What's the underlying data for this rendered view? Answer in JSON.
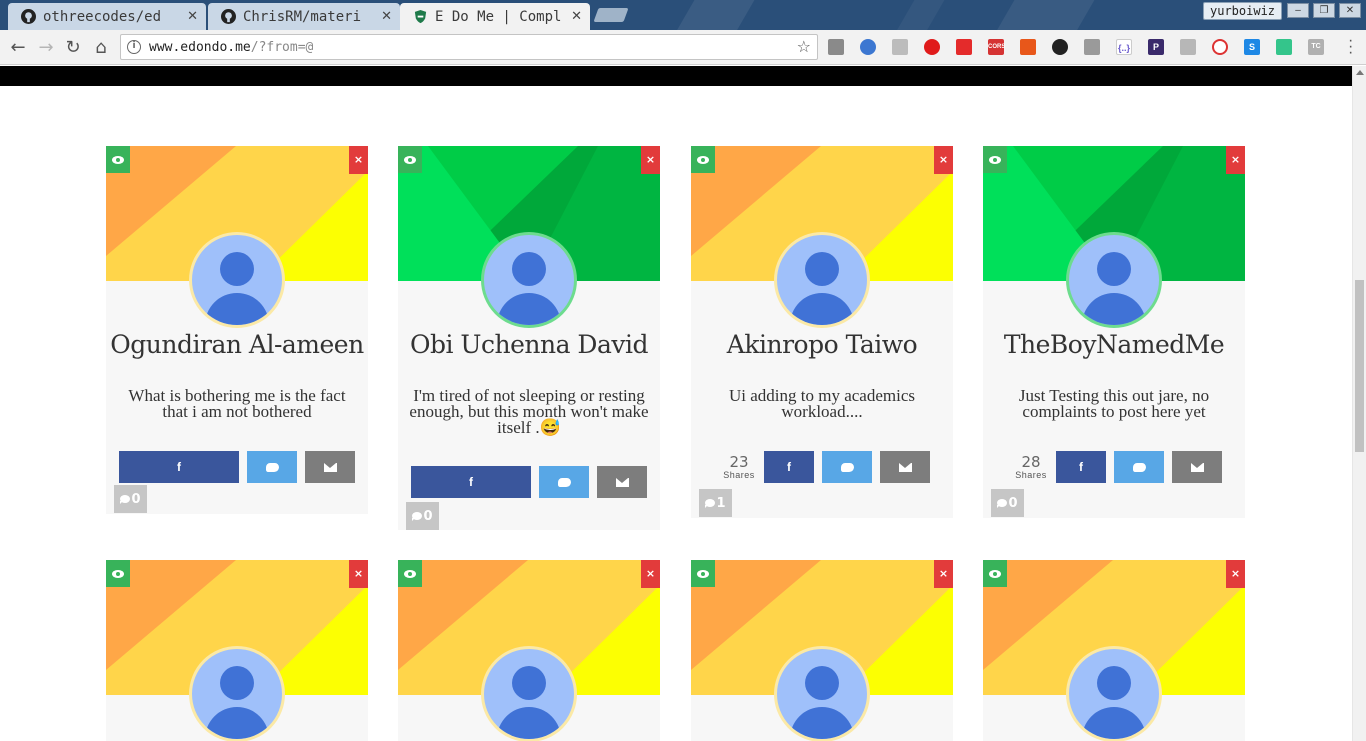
{
  "browser": {
    "tabs": [
      {
        "title": "othreecodes/ed",
        "icon": "github-icon"
      },
      {
        "title": "ChrisRM/materi",
        "icon": "github-icon"
      },
      {
        "title": "E Do Me | Compl",
        "icon": "shield-icon"
      }
    ],
    "profile": "yurboiwiz",
    "address": {
      "host": "www.edondo.me",
      "path": "/?from=@"
    }
  },
  "cards": [
    {
      "name": "Ogundiran Al-ameen",
      "message": "What is bothering me is the fact that i am not bothered",
      "theme": "orange",
      "shares": null,
      "comments": "0"
    },
    {
      "name": "Obi Uchenna David",
      "message": "I'm tired of not sleeping or resting enough, but this month won't make itself .😅",
      "theme": "green",
      "shares": null,
      "comments": "0"
    },
    {
      "name": "Akinropo Taiwo",
      "message": "Ui adding to my academics workload....",
      "theme": "orange",
      "shares": "23",
      "comments": "1"
    },
    {
      "name": "TheBoyNamedMe",
      "message": "Just Testing this out jare, no complaints to post here yet",
      "theme": "green",
      "shares": "28",
      "comments": "0"
    }
  ],
  "labels": {
    "shares": "Shares",
    "facebook": "f",
    "close": "×"
  },
  "colors": {
    "facebook": "#3a569c",
    "twitter": "#58a7e6",
    "email": "#7d7d7d",
    "view": "#38b35a",
    "delete": "#e23b3b"
  }
}
